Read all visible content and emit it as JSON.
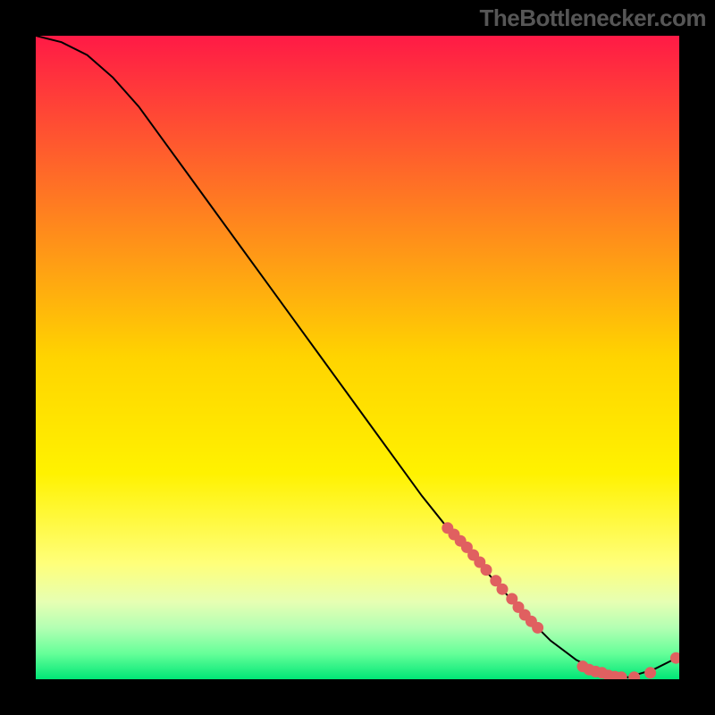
{
  "watermark": "TheBottlenecker.com",
  "chart_data": {
    "type": "line",
    "title": "",
    "xlabel": "",
    "ylabel": "",
    "xlim": [
      0,
      100
    ],
    "ylim": [
      0,
      100
    ],
    "x": [
      0,
      4,
      8,
      12,
      16,
      20,
      24,
      28,
      32,
      36,
      40,
      44,
      48,
      52,
      56,
      60,
      64,
      68,
      72,
      76,
      80,
      84,
      88,
      92,
      96,
      100
    ],
    "values": [
      100,
      99,
      97,
      93.5,
      89,
      83.5,
      78,
      72.5,
      67,
      61.5,
      56,
      50.5,
      45,
      39.5,
      34,
      28.5,
      23.5,
      19,
      14.5,
      10,
      6,
      3,
      1,
      0.3,
      1.5,
      3.5
    ],
    "bottleneck_markers_x": [
      64,
      65,
      66,
      67,
      68,
      69,
      70,
      71.5,
      72.5,
      74,
      75,
      76,
      77,
      78,
      85,
      86,
      87,
      88,
      89,
      90,
      91,
      93,
      95.5,
      99.5
    ],
    "bottleneck_markers_y": [
      23.5,
      22.5,
      21.5,
      20.5,
      19.3,
      18.2,
      17,
      15.3,
      14,
      12.5,
      11.2,
      10,
      9,
      8,
      2,
      1.5,
      1.2,
      1,
      0.6,
      0.4,
      0.3,
      0.3,
      1,
      3.3
    ],
    "gradient_stops": [
      {
        "offset": 0.0,
        "color": "#ff1a46"
      },
      {
        "offset": 0.5,
        "color": "#ffd400"
      },
      {
        "offset": 0.68,
        "color": "#fff200"
      },
      {
        "offset": 0.82,
        "color": "#ffff7a"
      },
      {
        "offset": 0.88,
        "color": "#e6ffb3"
      },
      {
        "offset": 0.92,
        "color": "#b3ffb3"
      },
      {
        "offset": 0.96,
        "color": "#66ff99"
      },
      {
        "offset": 1.0,
        "color": "#00e676"
      }
    ]
  }
}
